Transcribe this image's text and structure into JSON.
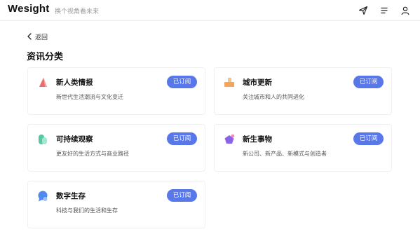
{
  "header": {
    "logo": "Wesight",
    "slogan": "换个视角看未来",
    "icons": [
      "send-icon",
      "menu-icon",
      "user-icon"
    ]
  },
  "nav": {
    "back_label": "返回"
  },
  "page_title": "资讯分类",
  "colors": {
    "accent": "#5877e9",
    "icon_red": "#ec6a6a",
    "icon_orange": "#f3a65a",
    "icon_green": "#54c9a1",
    "icon_purple": "#8b63e8",
    "icon_blue": "#4f8af0"
  },
  "categories": [
    {
      "title": "新人类情报",
      "desc": "新世代生活潮流与文化变迁",
      "button": "已订阅",
      "icon": "triangle-icon"
    },
    {
      "title": "城市更新",
      "desc": "关注城市和人的共同进化",
      "button": "已订阅",
      "icon": "blocks-icon"
    },
    {
      "title": "可持续观察",
      "desc": "更友好的生活方式与商业路径",
      "button": "已订阅",
      "icon": "leaf-icon"
    },
    {
      "title": "新生事物",
      "desc": "新公司、新产品、新模式与创造者",
      "button": "已订阅",
      "icon": "pentagon-icon"
    },
    {
      "title": "数字生存",
      "desc": "科技与我们的生活和生存",
      "button": "已订阅",
      "icon": "chat-bubble-icon"
    }
  ]
}
